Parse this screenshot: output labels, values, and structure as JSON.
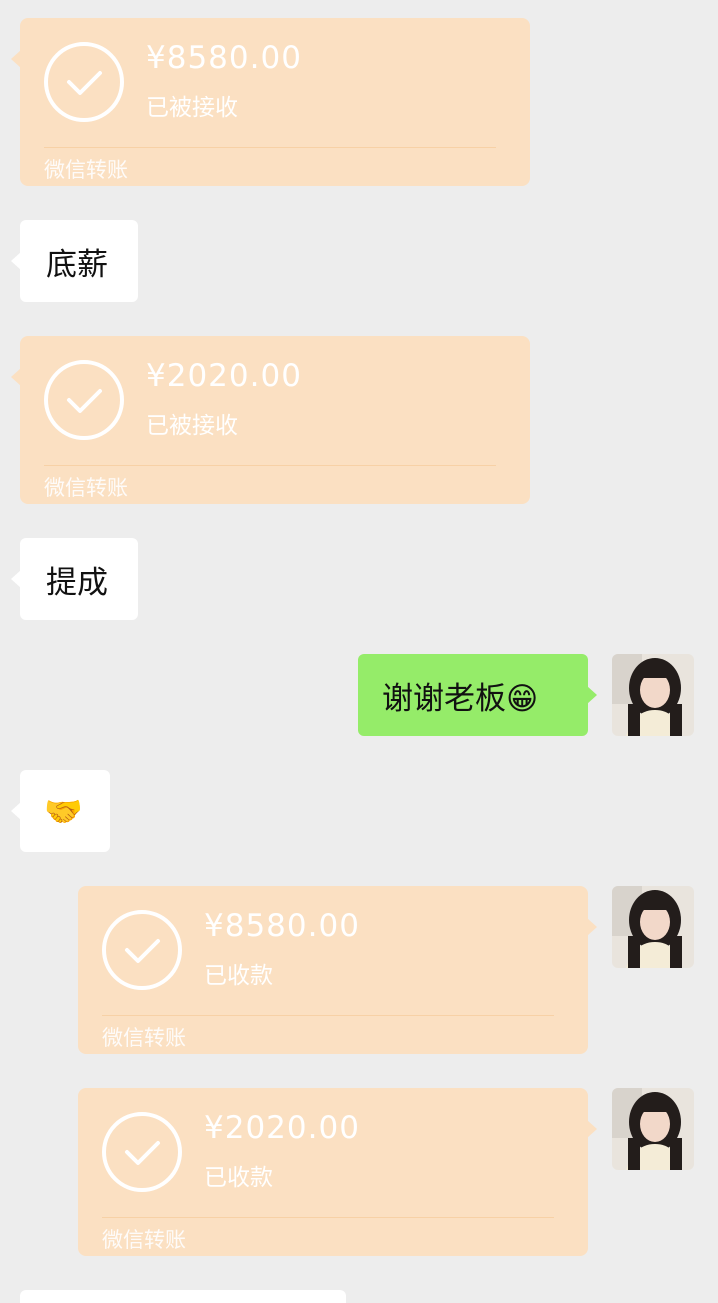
{
  "messages": [
    {
      "type": "transfer",
      "side": "left",
      "amount": "¥8580.00",
      "status": "已被接收",
      "footer": "微信转账"
    },
    {
      "type": "text",
      "side": "left",
      "text": "底薪"
    },
    {
      "type": "transfer",
      "side": "left",
      "amount": "¥2020.00",
      "status": "已被接收",
      "footer": "微信转账"
    },
    {
      "type": "text",
      "side": "left",
      "text": "提成"
    },
    {
      "type": "text",
      "side": "right",
      "text": "谢谢老板😁"
    },
    {
      "type": "text",
      "side": "left",
      "text": "🤝"
    },
    {
      "type": "transfer",
      "side": "right",
      "amount": "¥8580.00",
      "status": "已收款",
      "footer": "微信转账"
    },
    {
      "type": "transfer",
      "side": "right",
      "amount": "¥2020.00",
      "status": "已收款",
      "footer": "微信转账"
    }
  ],
  "colors": {
    "background": "#ededed",
    "transfer_bg": "#fbe0c2",
    "self_bubble": "#95ec69",
    "other_bubble": "#ffffff"
  }
}
